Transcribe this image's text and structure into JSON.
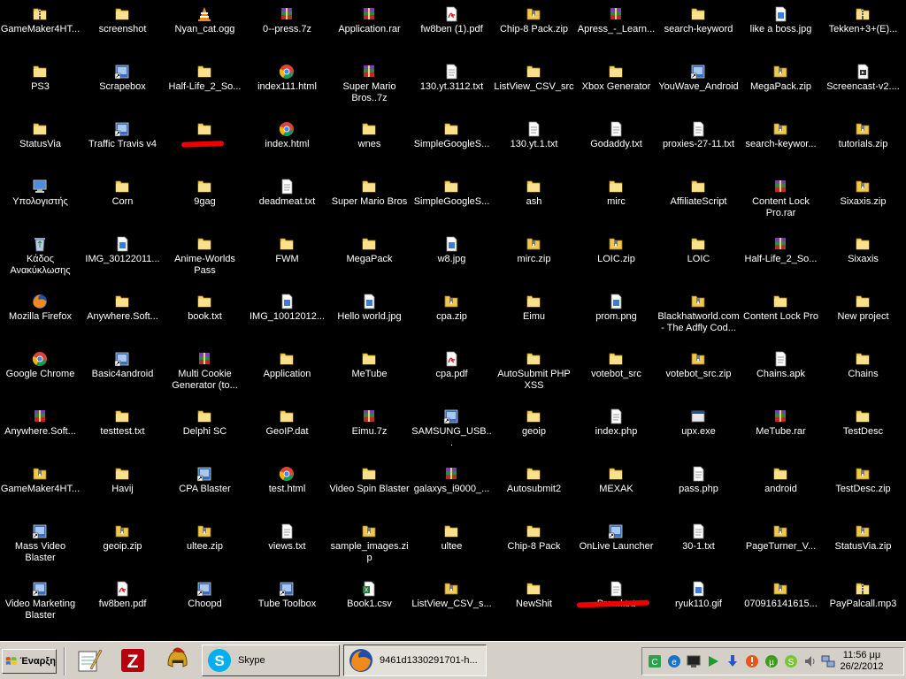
{
  "desktop": {
    "icons": [
      {
        "label": "GameMaker4HT...",
        "icon": "folder-zip"
      },
      {
        "label": "screenshot",
        "icon": "folder"
      },
      {
        "label": "Nyan_cat.ogg",
        "icon": "vlc-media"
      },
      {
        "label": "0--press.7z",
        "icon": "winrar-archive"
      },
      {
        "label": "Application.rar",
        "icon": "winrar-archive"
      },
      {
        "label": "fw8ben (1).pdf",
        "icon": "pdf"
      },
      {
        "label": "Chip-8 Pack.zip",
        "icon": "zip"
      },
      {
        "label": "Apress_-_Learn...",
        "icon": "winrar-archive"
      },
      {
        "label": "search-keyword",
        "icon": "folder"
      },
      {
        "label": "like a boss.jpg",
        "icon": "image"
      },
      {
        "label": "Tekken+3+(E)...",
        "icon": "folder-zip"
      },
      {
        "label": "PS3",
        "icon": "folder"
      },
      {
        "label": "Scrapebox",
        "icon": "app-shortcut"
      },
      {
        "label": "Half-Life_2_So...",
        "icon": "folder"
      },
      {
        "label": "index111.html",
        "icon": "chrome"
      },
      {
        "label": "Super Mario Bros..7z",
        "icon": "winrar-archive"
      },
      {
        "label": "130.yt.3112.txt",
        "icon": "text"
      },
      {
        "label": "ListView_CSV_src",
        "icon": "folder"
      },
      {
        "label": "Xbox Generator",
        "icon": "folder"
      },
      {
        "label": "YouWave_Android",
        "icon": "app-shortcut"
      },
      {
        "label": "MegaPack.zip",
        "icon": "zip"
      },
      {
        "label": "Screencast-v2....",
        "icon": "video"
      },
      {
        "label": "StatusVia",
        "icon": "folder"
      },
      {
        "label": "Traffic Travis v4",
        "icon": "app-shortcut"
      },
      {
        "label": "",
        "icon": "folder",
        "redacted": true
      },
      {
        "label": "index.html",
        "icon": "chrome"
      },
      {
        "label": "wnes",
        "icon": "folder"
      },
      {
        "label": "SimpleGoogleS...",
        "icon": "folder"
      },
      {
        "label": "130.yt.1.txt",
        "icon": "text"
      },
      {
        "label": "Godaddy.txt",
        "icon": "text"
      },
      {
        "label": "proxies-27-11.txt",
        "icon": "text"
      },
      {
        "label": "search-keywor...",
        "icon": "zip"
      },
      {
        "label": "tutorials.zip",
        "icon": "zip"
      },
      {
        "label": "Υπολογιστής",
        "icon": "computer"
      },
      {
        "label": "Corn",
        "icon": "folder"
      },
      {
        "label": "9gag",
        "icon": "folder"
      },
      {
        "label": "deadmeat.txt",
        "icon": "text"
      },
      {
        "label": "Super Mario Bros",
        "icon": "folder"
      },
      {
        "label": "SimpleGoogleS...",
        "icon": "folder"
      },
      {
        "label": "ash",
        "icon": "folder"
      },
      {
        "label": "mirc",
        "icon": "folder"
      },
      {
        "label": "AffiliateScript",
        "icon": "folder"
      },
      {
        "label": "Content Lock Pro.rar",
        "icon": "winrar-archive"
      },
      {
        "label": "Sixaxis.zip",
        "icon": "zip"
      },
      {
        "label": "Κάδος Ανακύκλωσης",
        "icon": "recycle-bin"
      },
      {
        "label": "IMG_30122011...",
        "icon": "image"
      },
      {
        "label": "Anime-Worlds Pass",
        "icon": "folder"
      },
      {
        "label": "FWM",
        "icon": "folder"
      },
      {
        "label": "MegaPack",
        "icon": "folder"
      },
      {
        "label": "w8.jpg",
        "icon": "image"
      },
      {
        "label": "mirc.zip",
        "icon": "zip"
      },
      {
        "label": "LOIC.zip",
        "icon": "zip"
      },
      {
        "label": "LOIC",
        "icon": "folder"
      },
      {
        "label": "Half-Life_2_So...",
        "icon": "winrar-archive"
      },
      {
        "label": "Sixaxis",
        "icon": "folder"
      },
      {
        "label": "Mozilla Firefox",
        "icon": "firefox"
      },
      {
        "label": "Anywhere.Soft...",
        "icon": "folder"
      },
      {
        "label": "book.txt",
        "icon": "folder"
      },
      {
        "label": "IMG_10012012...",
        "icon": "image"
      },
      {
        "label": "Hello world.jpg",
        "icon": "image"
      },
      {
        "label": "cpa.zip",
        "icon": "zip"
      },
      {
        "label": "Eimu",
        "icon": "folder"
      },
      {
        "label": "prom.png",
        "icon": "image"
      },
      {
        "label": "Blackhatworld.com - The Adfly Cod...",
        "icon": "zip"
      },
      {
        "label": "Content Lock  Pro",
        "icon": "folder"
      },
      {
        "label": "New project",
        "icon": "folder"
      },
      {
        "label": "Google Chrome",
        "icon": "chrome"
      },
      {
        "label": "Basic4android",
        "icon": "app-shortcut"
      },
      {
        "label": "Multi Cookie Generator (to...",
        "icon": "winrar-archive"
      },
      {
        "label": "Application",
        "icon": "folder"
      },
      {
        "label": "MeTube",
        "icon": "folder"
      },
      {
        "label": "cpa.pdf",
        "icon": "pdf"
      },
      {
        "label": "AutoSubmit PHP XSS",
        "icon": "folder"
      },
      {
        "label": "votebot_src",
        "icon": "folder"
      },
      {
        "label": "votebot_src.zip",
        "icon": "zip"
      },
      {
        "label": "Chains.apk",
        "icon": "text"
      },
      {
        "label": "Chains",
        "icon": "folder"
      },
      {
        "label": "Anywhere.Soft...",
        "icon": "winrar-archive"
      },
      {
        "label": "testtest.txt",
        "icon": "folder"
      },
      {
        "label": "Delphi SC",
        "icon": "folder"
      },
      {
        "label": "GeoIP.dat",
        "icon": "folder"
      },
      {
        "label": "Eimu.7z",
        "icon": "winrar-archive"
      },
      {
        "label": "SAMSUNG_USB...",
        "icon": "app-shortcut"
      },
      {
        "label": "geoip",
        "icon": "folder"
      },
      {
        "label": "index.php",
        "icon": "text"
      },
      {
        "label": "upx.exe",
        "icon": "exe"
      },
      {
        "label": "MeTube.rar",
        "icon": "winrar-archive"
      },
      {
        "label": "TestDesc",
        "icon": "folder"
      },
      {
        "label": "GameMaker4HT...",
        "icon": "zip"
      },
      {
        "label": "Havij",
        "icon": "folder"
      },
      {
        "label": "CPA Blaster",
        "icon": "app-shortcut"
      },
      {
        "label": "test.html",
        "icon": "chrome"
      },
      {
        "label": "Video Spin Blaster",
        "icon": "folder"
      },
      {
        "label": "galaxys_i9000_...",
        "icon": "winrar-archive"
      },
      {
        "label": "Autosubmit2",
        "icon": "folder"
      },
      {
        "label": "MEXAK",
        "icon": "folder"
      },
      {
        "label": "pass.php",
        "icon": "text"
      },
      {
        "label": "android",
        "icon": "folder"
      },
      {
        "label": "TestDesc.zip",
        "icon": "zip"
      },
      {
        "label": "Mass Video Blaster",
        "icon": "app-shortcut"
      },
      {
        "label": "geoip.zip",
        "icon": "zip"
      },
      {
        "label": "ultee.zip",
        "icon": "zip"
      },
      {
        "label": "views.txt",
        "icon": "text"
      },
      {
        "label": "sample_images.zip",
        "icon": "zip"
      },
      {
        "label": "ultee",
        "icon": "folder"
      },
      {
        "label": "Chip-8 Pack",
        "icon": "folder"
      },
      {
        "label": "OnLive Launcher",
        "icon": "app-shortcut"
      },
      {
        "label": "30-1.txt",
        "icon": "text"
      },
      {
        "label": "PageTurner_V...",
        "icon": "zip"
      },
      {
        "label": "StatusVia.zip",
        "icon": "zip"
      },
      {
        "label": "Video Marketing Blaster",
        "icon": "app-shortcut"
      },
      {
        "label": "fw8ben.pdf",
        "icon": "pdf"
      },
      {
        "label": "Choopd",
        "icon": "app-shortcut"
      },
      {
        "label": "Tube Toolbox",
        "icon": "app-shortcut"
      },
      {
        "label": "Book1.csv",
        "icon": "excel"
      },
      {
        "label": "ListView_CSV_s...",
        "icon": "zip"
      },
      {
        "label": "NewShit",
        "icon": "folder"
      },
      {
        "label": "Pro...l.txt",
        "icon": "text",
        "redacted": true,
        "visible_suffix": "l.txt"
      },
      {
        "label": "ryuk110.gif",
        "icon": "image"
      },
      {
        "label": "070916141615...",
        "icon": "zip"
      },
      {
        "label": "PayPalcall.mp3",
        "icon": "folder-zip"
      }
    ]
  },
  "taskbar": {
    "start_label": "Έναρξη",
    "quick_launch": [
      {
        "name": "notepad-quicklaunch"
      },
      {
        "name": "filezilla-quicklaunch"
      },
      {
        "name": "spartan-quicklaunch"
      }
    ],
    "tasks": [
      {
        "label": "Skype",
        "icon": "skype",
        "active": false
      },
      {
        "label": "9461d1330291701-h...",
        "icon": "firefox",
        "active": true
      }
    ],
    "tray": {
      "time": "11:56 μμ",
      "date": "26/2/2012"
    }
  },
  "colors": {
    "desktop": "#000000",
    "taskbar": "#d4d0c8",
    "folder": "#f5d76e",
    "redaction": "#e00000"
  }
}
